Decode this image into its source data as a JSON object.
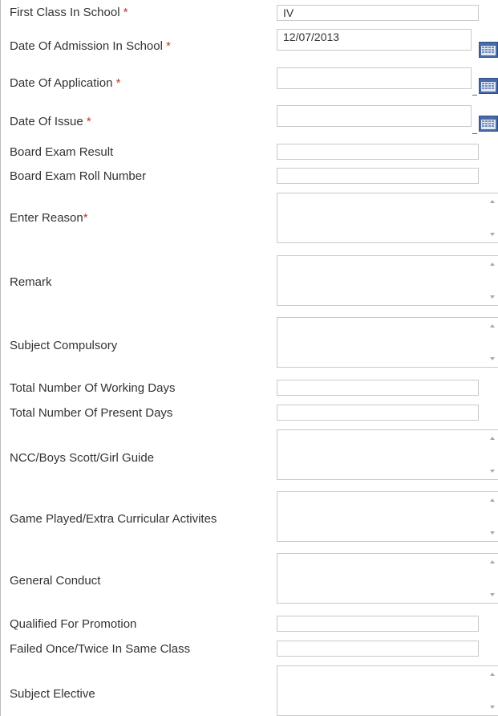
{
  "fields": {
    "first_class": {
      "label": "First Class In School",
      "required": "*",
      "value": "IV"
    },
    "date_admission": {
      "label": "Date Of Admission In School",
      "required": "*",
      "value": "12/07/2013"
    },
    "date_application": {
      "label": "Date Of Application",
      "required": "*",
      "value": ""
    },
    "date_issue": {
      "label": "Date Of Issue",
      "required": "*",
      "value": ""
    },
    "board_exam_result": {
      "label": "Board Exam Result",
      "value": ""
    },
    "board_exam_roll": {
      "label": "Board Exam Roll Number",
      "value": ""
    },
    "enter_reason": {
      "label": "Enter Reason",
      "required": "*",
      "value": ""
    },
    "remark": {
      "label": "Remark",
      "value": ""
    },
    "subject_compulsory": {
      "label": "Subject Compulsory",
      "value": ""
    },
    "total_working_days": {
      "label": "Total Number Of Working Days",
      "value": ""
    },
    "total_present_days": {
      "label": "Total Number Of Present Days",
      "value": ""
    },
    "ncc": {
      "label": "NCC/Boys Scott/Girl Guide",
      "value": ""
    },
    "games_played": {
      "label": "Game Played/Extra Curricular Activites",
      "value": ""
    },
    "general_conduct": {
      "label": "General Conduct",
      "value": ""
    },
    "qualified_promotion": {
      "label": "Qualified For Promotion",
      "value": ""
    },
    "failed_once_twice": {
      "label": "Failed Once/Twice In Same Class",
      "value": ""
    },
    "subject_elective": {
      "label": "Subject Elective",
      "value": ""
    }
  },
  "icons": {
    "calendar": "calendar-icon",
    "scroll_up": "scroll-up-arrow-icon",
    "scroll_down": "scroll-down-arrow-icon"
  },
  "colors": {
    "required_marker": "#c0392b",
    "input_border": "#c9c9c9",
    "calendar_icon": "#4a6aa5",
    "label_text": "#333333"
  }
}
